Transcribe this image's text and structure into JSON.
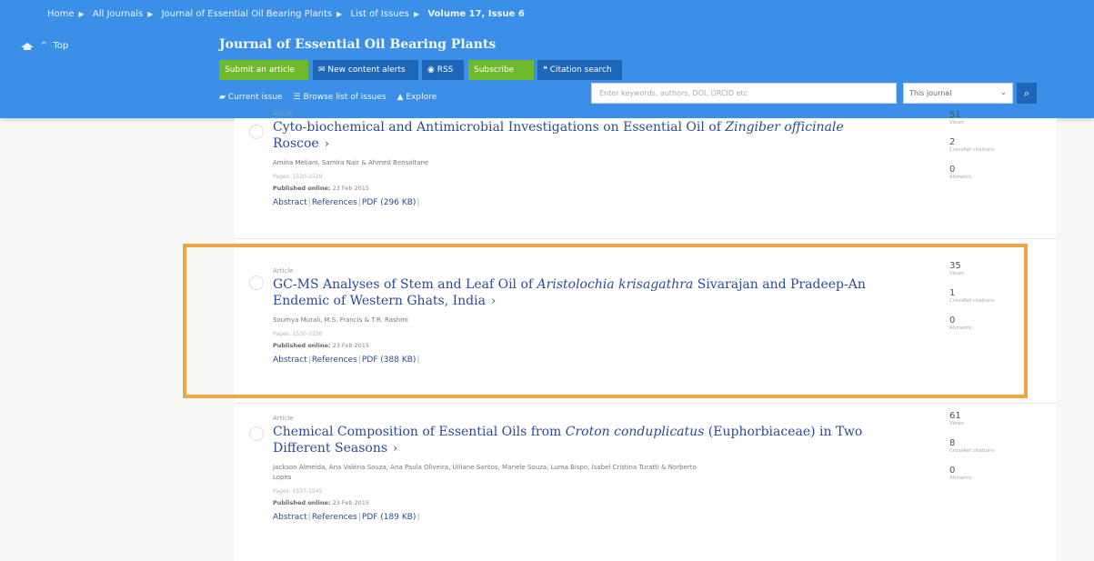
{
  "breadcrumb": {
    "items": [
      "Home",
      "All Journals",
      "Journal of Essential Oil Bearing Plants",
      "List of Issues"
    ],
    "current": "Volume 17, Issue 6"
  },
  "nav": {
    "top_label": "Top"
  },
  "journal": {
    "title": "Journal of Essential Oil Bearing Plants"
  },
  "toolbar": {
    "submit": "Submit an article",
    "alerts": "New content alerts",
    "rss": "RSS",
    "subscribe": "Subscribe",
    "citation": "Citation search"
  },
  "subnav": {
    "current_issue": "Current issue",
    "browse": "Browse list of issues",
    "explore": "Explore"
  },
  "search": {
    "placeholder": "Enter keywords, authors, DOI, ORCID etc",
    "scope": "This journal"
  },
  "colors": {
    "header_blue": "#3b8fe6",
    "green": "#6fba2c",
    "dark_blue": "#1f66b8",
    "highlight": "#f0a445",
    "link": "#2a4a99"
  },
  "articles": [
    {
      "type": "Article",
      "title_pre": "Cyto-biochemical and Antimicrobial Investigations on Essential Oil of ",
      "title_italic": "Zingiber officinale",
      "title_post": " Roscoe",
      "authors": "Amina Meliani, Samira Nair & Ahmed Bensoltane",
      "pages": "Pages: 1520-1529",
      "published_label": "Published online:",
      "published_date": "23 Feb 2015",
      "abstract": "Abstract",
      "references": "References",
      "pdf": "PDF (296 KB)",
      "views": "51",
      "views_label": "Views",
      "crossref": "2",
      "crossref_label": "CrossRef citations",
      "altmetric": "0",
      "altmetric_label": "Altmetric"
    },
    {
      "type": "Article",
      "title_pre": "GC-MS Analyses of Stem and Leaf Oil of ",
      "title_italic": "Aristolochia krisagathra",
      "title_post": " Sivarajan and Pradeep-An Endemic of Western Ghats, India",
      "authors": "Soumya Murali, M.S. Francis & T.R. Rashmi",
      "pages": "Pages: 1530-1536",
      "published_label": "Published online:",
      "published_date": "23 Feb 2015",
      "abstract": "Abstract",
      "references": "References",
      "pdf": "PDF (388 KB)",
      "views": "35",
      "views_label": "Views",
      "crossref": "1",
      "crossref_label": "CrossRef citations",
      "altmetric": "0",
      "altmetric_label": "Altmetric"
    },
    {
      "type": "Article",
      "title_pre": "Chemical Composition of Essential Oils from ",
      "title_italic": "Croton conduplicatus",
      "title_post": " (Euphorbiaceae) in Two Different Seasons",
      "authors": "Jackson Almeida, Ana Valéria Souza, Ana Paula Oliveira, Uiliane Santos, Mariele Souza, Luma Bispo, Isabel Cristina Turatti & Norberto Lopes",
      "pages": "Pages: 1537-1545",
      "published_label": "Published online:",
      "published_date": "23 Feb 2015",
      "abstract": "Abstract",
      "references": "References",
      "pdf": "PDF (189 KB)",
      "views": "61",
      "views_label": "Views",
      "crossref": "8",
      "crossref_label": "CrossRef citations",
      "altmetric": "0",
      "altmetric_label": "Altmetric"
    }
  ]
}
